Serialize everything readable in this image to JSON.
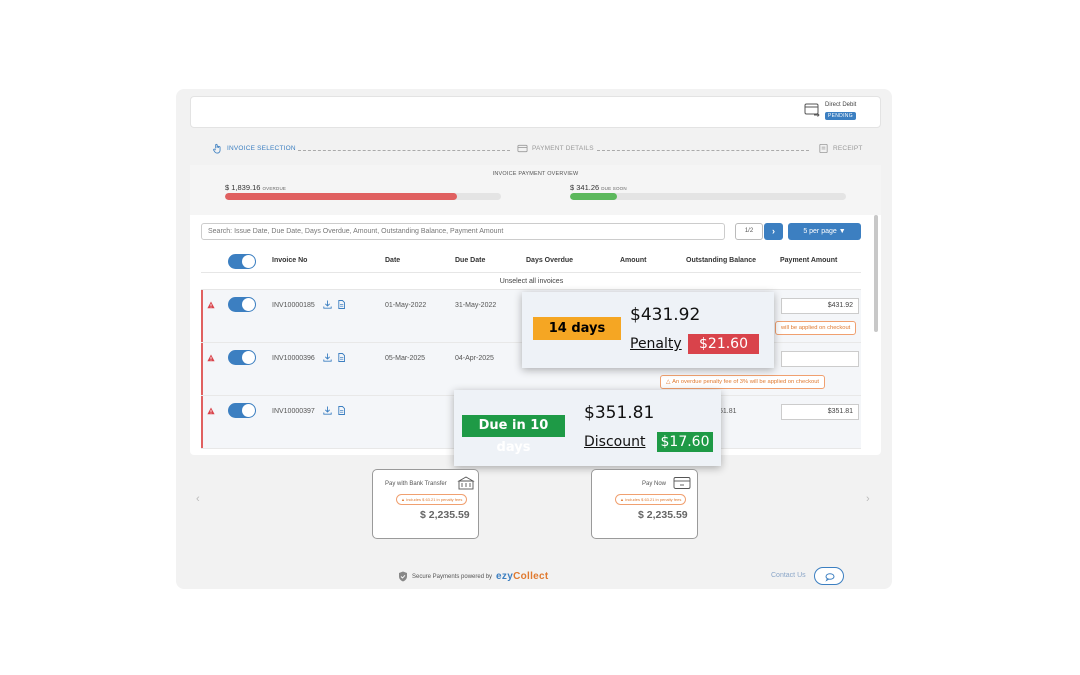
{
  "direct_debit": {
    "label": "Direct Debit",
    "status": "PENDING"
  },
  "steps": [
    {
      "label": "INVOICE SELECTION",
      "active": true
    },
    {
      "label": "PAYMENT DETAILS",
      "active": false
    },
    {
      "label": "RECEIPT",
      "active": false
    }
  ],
  "overview": {
    "title": "INVOICE PAYMENT OVERVIEW",
    "overdue": {
      "amount": "$ 1,839.16",
      "label": "OVERDUE",
      "fill": 0.84,
      "color": "#e06060"
    },
    "due_soon": {
      "amount": "$ 341.26",
      "label": "DUE SOON",
      "fill": 0.17,
      "color": "#5cb85c"
    }
  },
  "search": {
    "placeholder": "Search: Issue Date, Due Date, Days Overdue, Amount, Outstanding Balance, Payment Amount"
  },
  "pagination": {
    "page": "1/2",
    "next": "›",
    "per_page": "5 per page"
  },
  "columns": [
    "Invoice No",
    "Date",
    "Due Date",
    "Days Overdue",
    "Amount",
    "Outstanding Balance",
    "Payment Amount"
  ],
  "unselect_label": "Unselect all invoices",
  "rows": [
    {
      "invoice": "INV10000185",
      "date": "01-May-2022",
      "due": "31-May-2022",
      "payment": "$431.92",
      "note": "will be applied on checkout"
    },
    {
      "invoice": "INV10000396",
      "date": "05-Mar-2025",
      "due": "04-Apr-2025",
      "payment": "",
      "note": "An overdue penalty fee of 3% will be applied on checkout"
    },
    {
      "invoice": "INV10000397",
      "date": "",
      "due": "",
      "outstanding": "51.81",
      "payment": "$351.81"
    }
  ],
  "popup_penalty": {
    "badge": "14 days",
    "amount": "$431.92",
    "label": "Penalty",
    "value": "$21.60"
  },
  "popup_discount": {
    "badge": "Due in 10 days",
    "amount": "$351.81",
    "label": "Discount",
    "value": "$17.60"
  },
  "pay_options": [
    {
      "title": "Pay with Bank Transfer",
      "note": "Includes $ 63.21 in penalty fees",
      "amount": "$ 2,235.59"
    },
    {
      "title": "Pay Now",
      "note": "Includes $ 63.21 in penalty fees",
      "amount": "$ 2,235.59"
    }
  ],
  "carousel": {
    "prev": "‹",
    "next": "›"
  },
  "footer": {
    "secure": "Secure Payments powered by",
    "brand_a": "ezy",
    "brand_b": "Collect",
    "contact": "Contact Us"
  },
  "colors": {
    "accent": "#3c7fc1",
    "overdue": "#e06060",
    "due_soon": "#5cb85c",
    "penalty_badge": "#f5a623",
    "penalty_value": "#d9434b",
    "discount": "#1e9a46",
    "warning": "#e07a30"
  }
}
